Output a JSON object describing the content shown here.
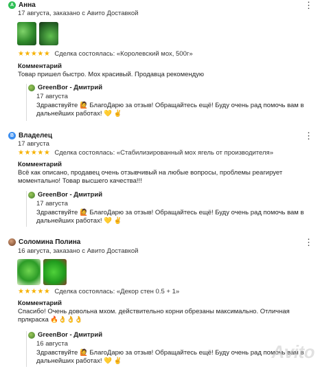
{
  "reviews": [
    {
      "avatar_letter": "А",
      "name": "Анна",
      "meta": "17 августа, заказано с Авито Доставкой",
      "stars": "★★★★★",
      "deal": "Сделка состоялась: «Королевский мох, 500г»",
      "comment_label": "Комментарий",
      "comment": "Товар пришел быстро. Мох красивый. Продавца рекомендую",
      "reply": {
        "name": "GreenBor - Дмитрий",
        "date": "17 августа",
        "text": "Здравствуйте 🙋 БлагоДарю за отзыв! Обращайтесь ещё! Буду очень рад помочь вам в дальнейших работах! 💛 ✌"
      }
    },
    {
      "avatar_letter": "В",
      "name": "Владелец",
      "meta": "17 августа",
      "stars": "★★★★★",
      "deal": "Сделка состоялась: «Стабилизированный мох ягель от производителя»",
      "comment_label": "Комментарий",
      "comment": "Всё как описано, продавец очень отзывчивый на любые вопросы, проблемы реагирует моментально! Товар высшего качества!!!",
      "reply": {
        "name": "GreenBor - Дмитрий",
        "date": "17 августа",
        "text": "Здравствуйте 🙋 БлагоДарю за отзыв! Обращайтесь ещё! Буду очень рад помочь вам в дальнейших работах! 💛 ✌"
      }
    },
    {
      "name": "Соломина Полина",
      "meta": "16 августа, заказано с Авито Доставкой",
      "stars": "★★★★★",
      "deal": "Сделка состоялась: «Декор стен 0.5 + 1»",
      "comment_label": "Комментарий",
      "comment": "Спасибо! Очень довольна мхом. действительно корни обрезаны максимально. Отличная прлкраска 🔥👌👌👌",
      "reply": {
        "name": "GreenBor - Дмитрий",
        "date": "16 августа",
        "text": "Здравствуйте 🙋 БлагоДарю за отзыв! Обращайтесь ещё! Буду очень рад помочь вам в дальнейших работах! 💛 ✌"
      }
    }
  ],
  "more_icon": "⋮",
  "watermark": "Avito"
}
